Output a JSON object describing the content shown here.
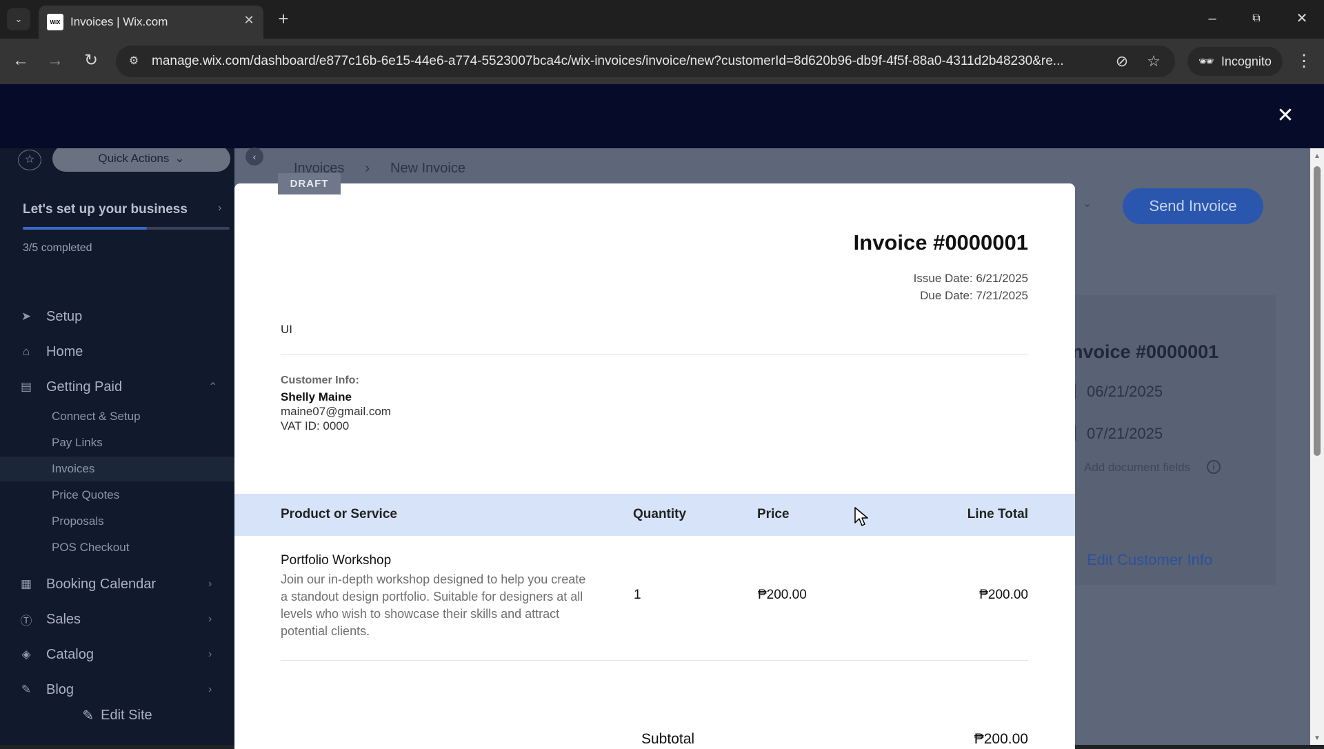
{
  "browser": {
    "tab_title": "Invoices | Wix.com",
    "favicon_text": "WiX",
    "url": "manage.wix.com/dashboard/e877c16b-6e15-44e6-a774-5523007bca4c/wix-invoices/invoice/new?customerId=8d620b96-db9f-4f5f-88a0-4311d2b48230&re...",
    "incognito_label": "Incognito"
  },
  "sidebar": {
    "quick_actions": "Quick Actions",
    "setup_title": "Let's set up your business",
    "progress_text": "3/5 completed",
    "progress_fraction": 0.6,
    "items": [
      {
        "label": "Setup",
        "icon": "rocket-icon"
      },
      {
        "label": "Home",
        "icon": "home-icon"
      },
      {
        "label": "Getting Paid",
        "icon": "receipt-icon"
      }
    ],
    "sub_items": [
      "Connect & Setup",
      "Pay Links",
      "Invoices",
      "Price Quotes",
      "Proposals",
      "POS Checkout"
    ],
    "lower_items": [
      {
        "label": "Booking Calendar",
        "icon": "calendar-icon"
      },
      {
        "label": "Sales",
        "icon": "dollar-icon"
      },
      {
        "label": "Catalog",
        "icon": "tag-icon"
      },
      {
        "label": "Blog",
        "icon": "pen-icon"
      }
    ],
    "edit_site": "Edit Site"
  },
  "page": {
    "breadcrumb": [
      "Invoices",
      "New Invoice"
    ],
    "send_invoice": "Send Invoice",
    "panel_invoice_title": "nvoice #0000001",
    "issue_date_value": "06/21/2025",
    "due_date_value": "07/21/2025",
    "add_document_fields": "Add document fields",
    "edit_customer_info": "Edit Customer Info"
  },
  "invoice": {
    "status_badge": "DRAFT",
    "number": "Invoice #0000001",
    "issue_date": "Issue Date: 6/21/2025",
    "due_date": "Due Date: 7/21/2025",
    "business_name": "UI",
    "customer_label": "Customer Info:",
    "customer_name": "Shelly Maine",
    "customer_email": "maine07@gmail.com",
    "customer_vat": "VAT ID: 0000",
    "columns": [
      "Product or Service",
      "Quantity",
      "Price",
      "Line Total"
    ],
    "line_items": [
      {
        "name": "Portfolio Workshop",
        "description": "Join our in-depth workshop designed to help you create a standout design portfolio. Suitable for designers at all levels who wish to showcase their skills and attract potential clients.",
        "quantity": "1",
        "price": "₱200.00",
        "line_total": "₱200.00"
      }
    ],
    "subtotal_label": "Subtotal",
    "subtotal_value": "₱200.00"
  }
}
